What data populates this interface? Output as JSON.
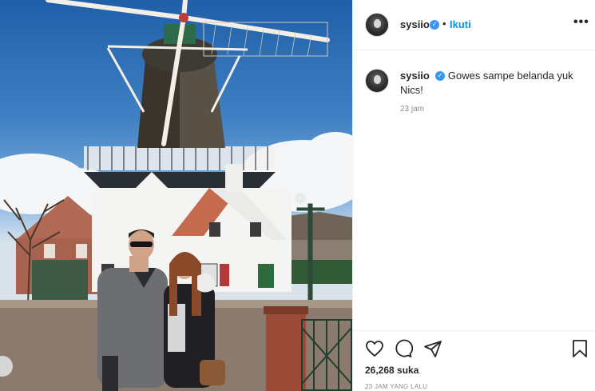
{
  "post": {
    "username": "sysiio",
    "follow_label": "Ikuti",
    "separator": "•",
    "more_label": "•••",
    "verified_mark": "✓"
  },
  "comment": {
    "username": "sysiio",
    "text": "Gowes sampe belanda yuk Nics!",
    "time": "23 jam"
  },
  "footer": {
    "likes": "26,268 suka",
    "time_ago": "23 JAM YANG LALU"
  },
  "icons": {
    "like": "heart-icon",
    "comment": "comment-bubble-icon",
    "share": "paper-plane-icon",
    "save": "bookmark-icon",
    "more": "ellipsis-icon"
  },
  "colors": {
    "follow": "#0095f6",
    "verified": "#3897f0",
    "muted": "#8e8e8e",
    "text": "#262626"
  }
}
